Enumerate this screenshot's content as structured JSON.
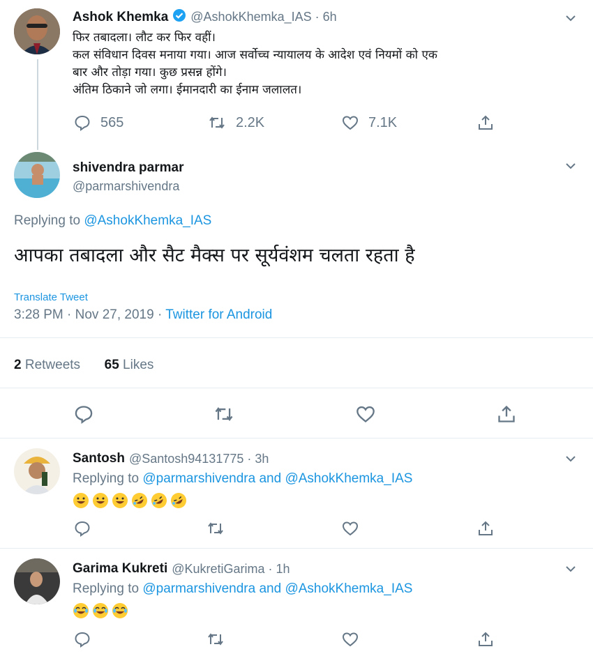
{
  "parent_tweet": {
    "name": "Ashok Khemka",
    "handle": "@AshokKhemka_IAS · 6h",
    "lines": [
      "फिर तबादला। लौट कर फिर वहीं।",
      "कल संविधान दिवस मनाया गया। आज सर्वोच्च न्यायालय के आदेश एवं नियमों को एक",
      "बार और तोड़ा गया। कुछ प्रसन्न होंगे।",
      "अंतिम ठिकाने जो लगा। ईमानदारी का ईनाम जलालत।"
    ],
    "replies": "565",
    "retweets": "2.2K",
    "likes": "7.1K"
  },
  "main_tweet": {
    "name": "shivendra parmar",
    "handle": "@parmarshivendra",
    "replying_prefix": "Replying to",
    "replying_to": "@AshokKhemka_IAS",
    "text": "आपका तबादला और सैट मैक्स पर सूर्यवंशम चलता रहता है",
    "translate": "Translate Tweet",
    "time": "3:28 PM · Nov 27, 2019 · ",
    "source": "Twitter for Android",
    "retweet_count": "2",
    "retweet_label": "Retweets",
    "like_count": "65",
    "like_label": "Likes"
  },
  "replies": [
    {
      "name": "Santosh",
      "handle": "@Santosh94131775 · 3h",
      "replying_prefix": "Replying to",
      "replying_to": "@parmarshivendra and @AshokKhemka_IAS",
      "emojis": [
        "grin",
        "grin",
        "grin",
        "rofl",
        "rofl",
        "rofl"
      ]
    },
    {
      "name": "Garima Kukreti",
      "handle": "@KukretiGarima · 1h",
      "replying_prefix": "Replying to",
      "replying_to": "@parmarshivendra and @AshokKhemka_IAS",
      "emojis": [
        "joy",
        "joy",
        "joy"
      ]
    }
  ],
  "colors": {
    "link": "#1b95e0",
    "secondary": "#657786",
    "verified": "#1da1f2",
    "divider": "#e6ecf0"
  }
}
